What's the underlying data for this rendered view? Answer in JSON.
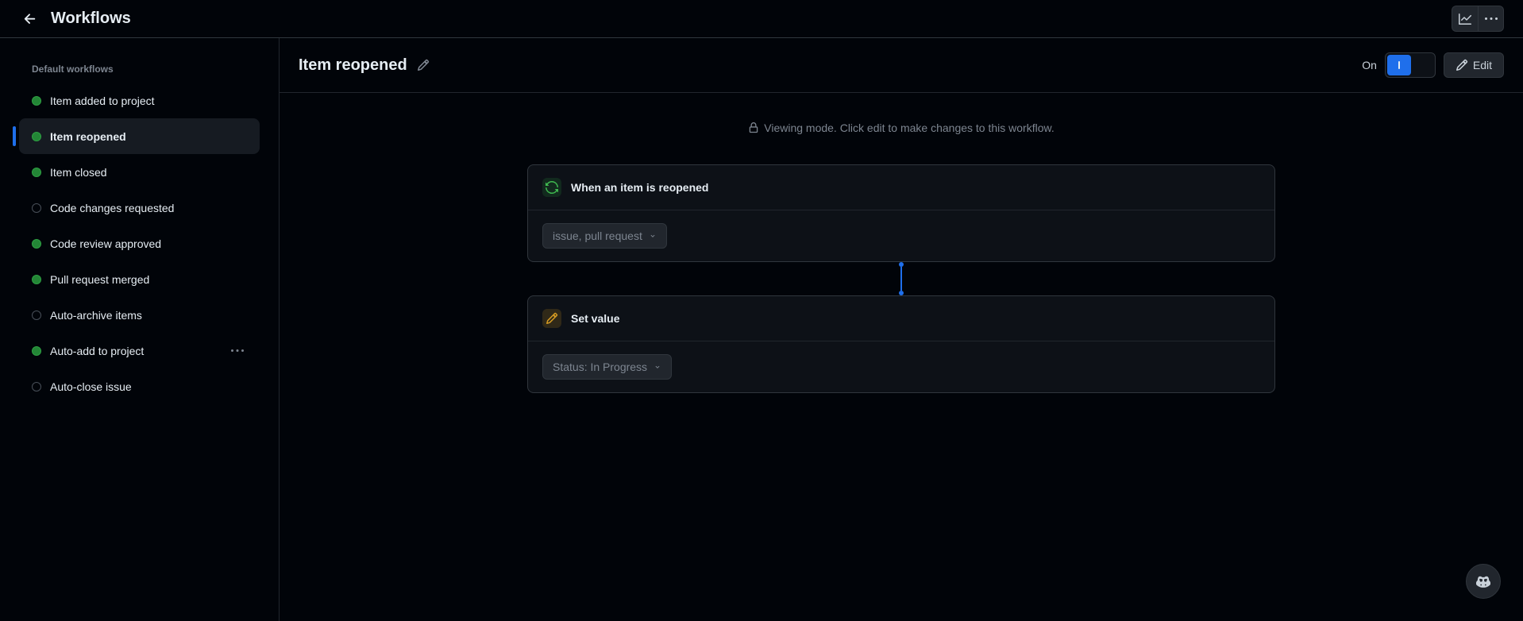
{
  "header": {
    "title": "Workflows"
  },
  "sidebar": {
    "heading": "Default workflows",
    "items": [
      {
        "label": "Item added to project",
        "on": true,
        "active": false,
        "menu": false
      },
      {
        "label": "Item reopened",
        "on": true,
        "active": true,
        "menu": false
      },
      {
        "label": "Item closed",
        "on": true,
        "active": false,
        "menu": false
      },
      {
        "label": "Code changes requested",
        "on": false,
        "active": false,
        "menu": false
      },
      {
        "label": "Code review approved",
        "on": true,
        "active": false,
        "menu": false
      },
      {
        "label": "Pull request merged",
        "on": true,
        "active": false,
        "menu": false
      },
      {
        "label": "Auto-archive items",
        "on": false,
        "active": false,
        "menu": false
      },
      {
        "label": "Auto-add to project",
        "on": true,
        "active": false,
        "menu": true
      },
      {
        "label": "Auto-close issue",
        "on": false,
        "active": false,
        "menu": false
      }
    ]
  },
  "content": {
    "title": "Item reopened",
    "toggle_label": "On",
    "edit_label": "Edit",
    "banner": "Viewing mode. Click edit to make changes to this workflow.",
    "trigger": {
      "title": "When an item is reopened",
      "chip": "issue, pull request"
    },
    "action": {
      "title": "Set value",
      "chip": "Status: In Progress"
    }
  }
}
